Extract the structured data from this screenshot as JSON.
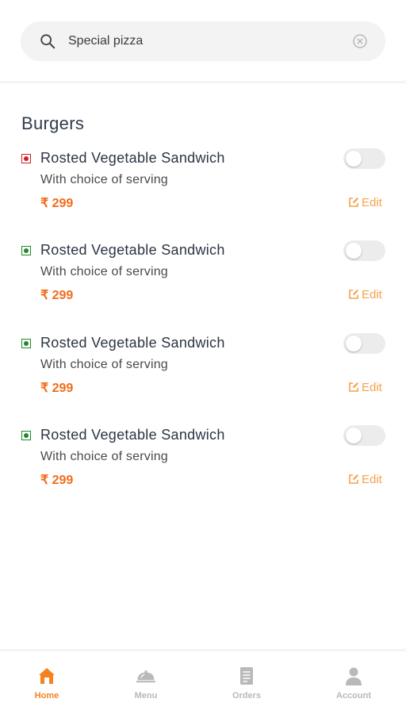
{
  "search": {
    "value": "Special pizza",
    "icon": "search-icon",
    "clear_icon": "clear-icon"
  },
  "section": {
    "title": "Burgers"
  },
  "colors": {
    "accent": "#f58220",
    "price": "#f26b1a",
    "nonveg": "#d21f26",
    "veg": "#1f8a2a",
    "edit": "#f5a24b"
  },
  "items": [
    {
      "title": "Rosted Vegetable Sandwich",
      "subtitle": "With choice of serving",
      "price": "₹ 299",
      "diet": "nonveg",
      "available": false,
      "edit_label": "Edit"
    },
    {
      "title": "Rosted Vegetable Sandwich",
      "subtitle": "With choice of serving",
      "price": "₹ 299",
      "diet": "veg",
      "available": false,
      "edit_label": "Edit"
    },
    {
      "title": "Rosted Vegetable Sandwich",
      "subtitle": "With choice of serving",
      "price": "₹ 299",
      "diet": "veg",
      "available": false,
      "edit_label": "Edit"
    },
    {
      "title": "Rosted Vegetable Sandwich",
      "subtitle": "With choice of serving",
      "price": "₹ 299",
      "diet": "veg",
      "available": false,
      "edit_label": "Edit"
    }
  ],
  "nav": {
    "active": "home",
    "items": [
      {
        "label": "Home",
        "icon": "home-icon"
      },
      {
        "label": "Menu",
        "icon": "cloche-icon"
      },
      {
        "label": "Orders",
        "icon": "receipt-icon"
      },
      {
        "label": "Account",
        "icon": "user-icon"
      }
    ]
  }
}
